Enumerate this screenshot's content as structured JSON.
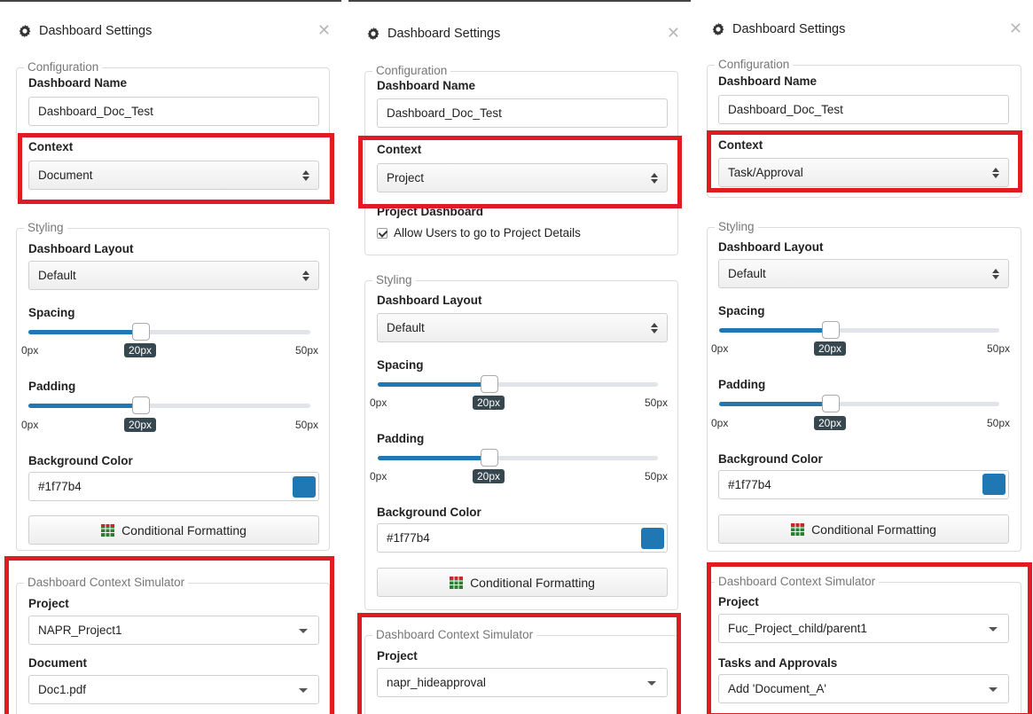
{
  "panels": [
    {
      "title": "Dashboard Settings",
      "configuration": {
        "legend": "Configuration",
        "name_label": "Dashboard Name",
        "name_value": "Dashboard_Doc_Test",
        "context_label": "Context",
        "context_value": "Document"
      },
      "styling": {
        "legend": "Styling",
        "layout_label": "Dashboard Layout",
        "layout_value": "Default",
        "spacing_label": "Spacing",
        "spacing": {
          "min": "0px",
          "max": "50px",
          "value_text": "20px",
          "fraction": 0.4
        },
        "padding_label": "Padding",
        "padding": {
          "min": "0px",
          "max": "50px",
          "value_text": "20px",
          "fraction": 0.4
        },
        "bg_label": "Background Color",
        "bg_value": "#1f77b4",
        "cf_label": "Conditional Formatting"
      },
      "simulator": {
        "legend": "Dashboard Context Simulator",
        "fields": [
          {
            "label": "Project",
            "value": "NAPR_Project1"
          },
          {
            "label": "Document",
            "value": "Doc1.pdf"
          }
        ]
      }
    },
    {
      "title": "Dashboard Settings",
      "configuration": {
        "legend": "Configuration",
        "name_label": "Dashboard Name",
        "name_value": "Dashboard_Doc_Test",
        "context_label": "Context",
        "context_value": "Project",
        "project_dashboard_label": "Project Dashboard",
        "allow_label": "Allow Users to go to Project Details"
      },
      "styling": {
        "legend": "Styling",
        "layout_label": "Dashboard Layout",
        "layout_value": "Default",
        "spacing_label": "Spacing",
        "spacing": {
          "min": "0px",
          "max": "50px",
          "value_text": "20px",
          "fraction": 0.4
        },
        "padding_label": "Padding",
        "padding": {
          "min": "0px",
          "max": "50px",
          "value_text": "20px",
          "fraction": 0.4
        },
        "bg_label": "Background Color",
        "bg_value": "#1f77b4",
        "cf_label": "Conditional Formatting"
      },
      "simulator": {
        "legend": "Dashboard Context Simulator",
        "fields": [
          {
            "label": "Project",
            "value": "napr_hideapproval"
          }
        ]
      }
    },
    {
      "title": "Dashboard Settings",
      "configuration": {
        "legend": "Configuration",
        "name_label": "Dashboard Name",
        "name_value": "Dashboard_Doc_Test",
        "context_label": "Context",
        "context_value": "Task/Approval"
      },
      "styling": {
        "legend": "Styling",
        "layout_label": "Dashboard Layout",
        "layout_value": "Default",
        "spacing_label": "Spacing",
        "spacing": {
          "min": "0px",
          "max": "50px",
          "value_text": "20px",
          "fraction": 0.4
        },
        "padding_label": "Padding",
        "padding": {
          "min": "0px",
          "max": "50px",
          "value_text": "20px",
          "fraction": 0.4
        },
        "bg_label": "Background Color",
        "bg_value": "#1f77b4",
        "cf_label": "Conditional Formatting"
      },
      "simulator": {
        "legend": "Dashboard Context Simulator",
        "fields": [
          {
            "label": "Project",
            "value": "Fuc_Project_child/parent1"
          },
          {
            "label": "Tasks and Approvals",
            "value": "Add 'Document_A'"
          }
        ]
      }
    }
  ],
  "colors": {
    "accent": "#1f77b4",
    "highlight": "#e01b24",
    "badge": "#37474f"
  },
  "icons": [
    "gear-icon",
    "close-icon",
    "up-down-arrows-icon",
    "caret-down-icon",
    "table-grid-icon"
  ]
}
